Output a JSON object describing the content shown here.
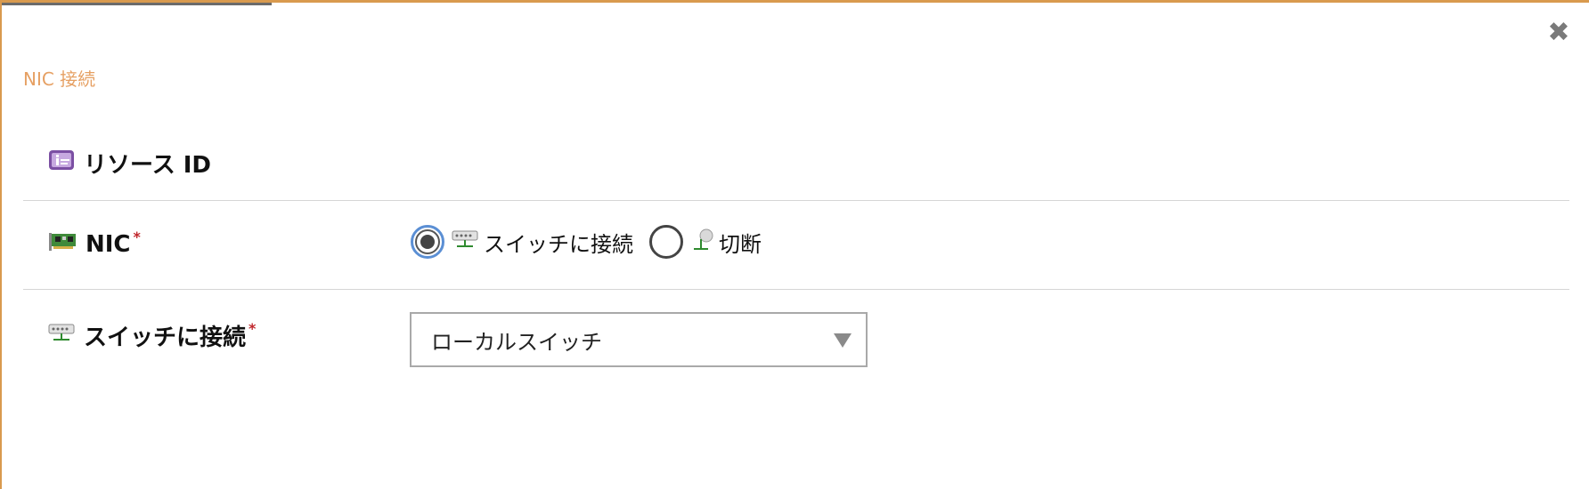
{
  "dialog": {
    "title": "NIC 接続",
    "close_icon": "close-icon"
  },
  "fields": {
    "resource_id": {
      "label": "リソース ID",
      "icon": "resource-id-icon"
    },
    "nic": {
      "label": "NIC",
      "required_mark": "*",
      "icon": "network-card-icon",
      "options": [
        {
          "label": "スイッチに接続",
          "icon": "switch-icon",
          "selected": true
        },
        {
          "label": "切断",
          "icon": "disconnect-icon",
          "selected": false
        }
      ]
    },
    "switch": {
      "label": "スイッチに接続",
      "required_mark": "*",
      "icon": "switch-icon",
      "selected_value": "ローカルスイッチ"
    }
  },
  "colors": {
    "accent": "#d99a4e",
    "title": "#e6a063",
    "required": "#c0262b",
    "radio_focus": "#5b8fd4"
  }
}
